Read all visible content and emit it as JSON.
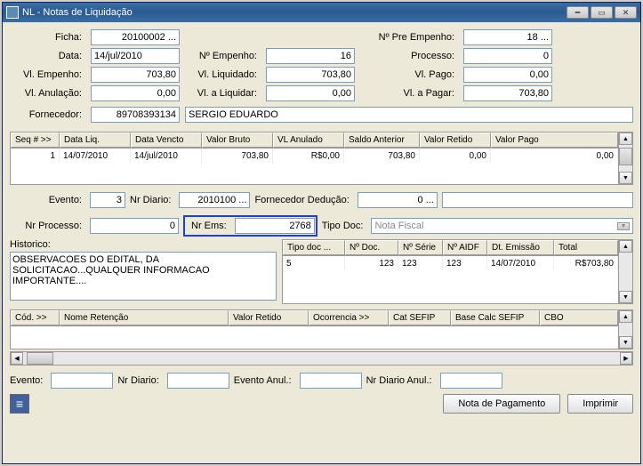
{
  "window": {
    "title": "NL - Notas de Liquidação"
  },
  "labels": {
    "ficha": "Ficha:",
    "data": "Data:",
    "vl_empenho": "Vl. Empenho:",
    "vl_anulacao": "Vl. Anulação:",
    "fornecedor": "Fornecedor:",
    "n_empenho": "Nº Empenho:",
    "vl_liquidado": "Vl. Liquidado:",
    "vl_a_liquidar": "Vl. a Liquidar:",
    "n_pre_empenho": "Nº Pre Empenho:",
    "processo": "Processo:",
    "vl_pago": "Vl. Pago:",
    "vl_a_pagar": "Vl. a Pagar:",
    "evento": "Evento:",
    "nr_diario": "Nr Diario:",
    "fornecedor_deducao": "Fornecedor Dedução:",
    "nr_processo": "Nr Processo:",
    "nr_ems": "Nr Ems:",
    "tipo_doc": "Tipo Doc:",
    "historico": "Historico:",
    "evento2": "Evento:",
    "nr_diario2": "Nr Diario:",
    "evento_anul": "Evento Anul.:",
    "nr_diario_anul": "Nr Diario Anul.:",
    "nota_pagamento": "Nota de Pagamento",
    "imprimir": "Imprimir"
  },
  "values": {
    "ficha": "20100002 ...",
    "data": "14/jul/2010",
    "vl_empenho": "703,80",
    "vl_anulacao": "0,00",
    "fornecedor_cod": "89708393134",
    "fornecedor_nome": "SERGIO EDUARDO",
    "n_empenho": "16",
    "vl_liquidado": "703,80",
    "vl_a_liquidar": "0,00",
    "n_pre_empenho": "18 ...",
    "processo": "0",
    "vl_pago": "0,00",
    "vl_a_pagar": "703,80",
    "evento": "3",
    "nr_diario": "2010100 ...",
    "fornecedor_deducao": "0 ...",
    "nr_processo": "0",
    "nr_ems": "2768",
    "tipo_doc": "Nota Fiscal",
    "historico_text": "OBSERVACOES DO EDITAL, DA SOLICITACAO...QUALQUER INFORMACAO IMPORTANTE...."
  },
  "grid1": {
    "headers": [
      "Seq # >>",
      "Data Liq.",
      "Data Vencto",
      "Valor Bruto",
      "VL Anulado",
      "Saldo Anterior",
      "Valor Retido",
      "Valor Pago"
    ],
    "rows": [
      [
        "1",
        "14/07/2010",
        "14/jul/2010",
        "703,80",
        "R$0,00",
        "703,80",
        "0,00",
        "0,00"
      ]
    ]
  },
  "docgrid": {
    "headers": [
      "Tipo doc ...",
      "Nº Doc.",
      "Nº Série",
      "Nº AIDF",
      "Dt. Emissão",
      "Total"
    ],
    "rows": [
      [
        "5",
        "123",
        "123",
        "123",
        "14/07/2010",
        "R$703,80"
      ]
    ]
  },
  "retgrid": {
    "headers": [
      "Cód. >>",
      "Nome Retenção",
      "Valor Retido",
      "Ocorrencia >>",
      "Cat SEFIP",
      "Base Calc SEFIP",
      "CBO"
    ]
  }
}
